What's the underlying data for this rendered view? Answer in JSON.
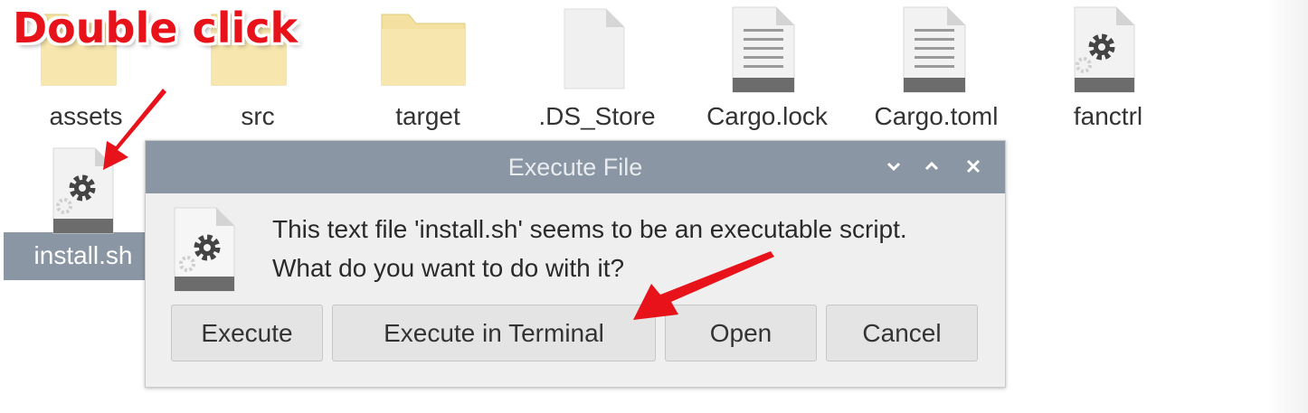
{
  "files": [
    {
      "name": "assets",
      "icon": "folder-icon"
    },
    {
      "name": "src",
      "icon": "folder-icon"
    },
    {
      "name": "target",
      "icon": "folder-icon"
    },
    {
      "name": ".DS_Store",
      "icon": "blank-file-icon"
    },
    {
      "name": "Cargo.lock",
      "icon": "text-file-icon"
    },
    {
      "name": "Cargo.toml",
      "icon": "text-file-icon"
    },
    {
      "name": "fanctrl",
      "icon": "executable-file-icon"
    },
    {
      "name": "install.sh",
      "icon": "executable-file-icon",
      "selected": true
    }
  ],
  "annotation": {
    "label": "Double click",
    "color": "#e8121b"
  },
  "dialog": {
    "title": "Execute File",
    "message_line1": "This text file 'install.sh' seems to be an executable script.",
    "message_line2": "What do you want to do with it?",
    "buttons": {
      "execute": "Execute",
      "execute_terminal": "Execute in Terminal",
      "open": "Open",
      "cancel": "Cancel"
    },
    "titlebar_color": "#8a96a3"
  },
  "colors": {
    "folder": "#f6e3a5",
    "selection": "#8a96a3",
    "arrow": "#e8121b"
  }
}
